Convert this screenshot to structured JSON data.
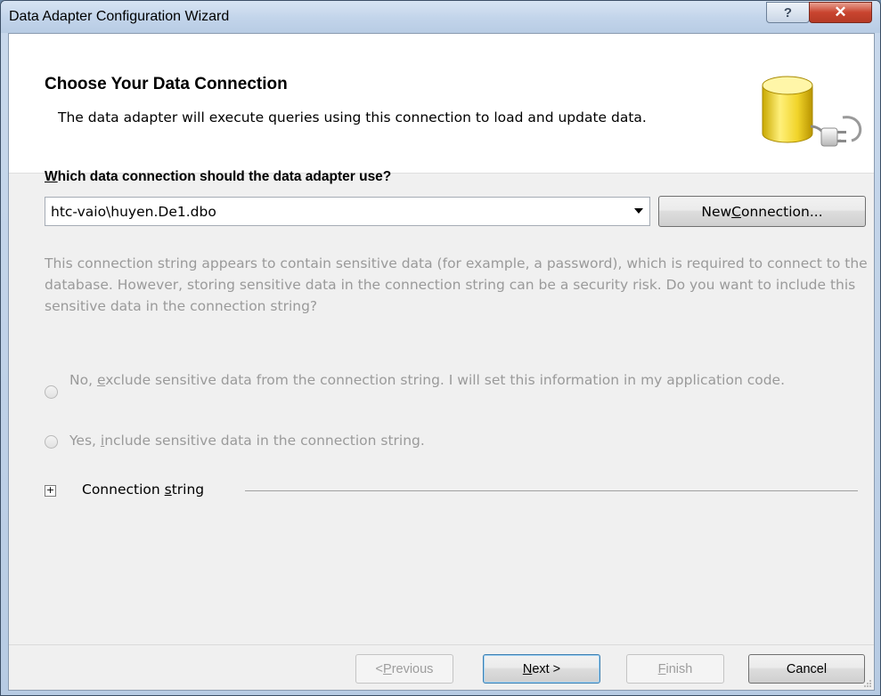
{
  "window": {
    "title": "Data Adapter Configuration Wizard",
    "help_label": "?",
    "close_label": "✕"
  },
  "header": {
    "title": "Choose Your Data Connection",
    "description": "The data adapter will execute queries using this connection to load and update data.",
    "icon": "database-plug-icon"
  },
  "connection": {
    "question_prefix": "W",
    "question_rest": "hich data connection should the data adapter use?",
    "selected_value": "htc-vaio\\huyen.De1.dbo",
    "new_connection_prefix": "New ",
    "new_connection_accel": "C",
    "new_connection_rest": "onnection..."
  },
  "sensitive": {
    "warning": "This connection string appears to contain sensitive data (for example, a password), which is required to connect to the database. However, storing sensitive data in the connection string can be a security risk. Do you want to include this sensitive data in the connection string?",
    "option_no_prefix": "No, ",
    "option_no_accel": "e",
    "option_no_rest": "xclude sensitive data from the connection string. I will set this information in my application code.",
    "option_yes_prefix": "Yes, ",
    "option_yes_accel": "i",
    "option_yes_rest": "nclude sensitive data in the connection string."
  },
  "connection_string": {
    "expand_glyph": "+",
    "label_prefix": "Connection ",
    "label_accel": "s",
    "label_rest": "tring"
  },
  "footer": {
    "previous_accel": "P",
    "previous_prefix": "< ",
    "previous_rest": "revious",
    "next_accel": "N",
    "next_rest": "ext >",
    "finish_accel": "F",
    "finish_rest": "inish",
    "cancel_label": "Cancel"
  }
}
